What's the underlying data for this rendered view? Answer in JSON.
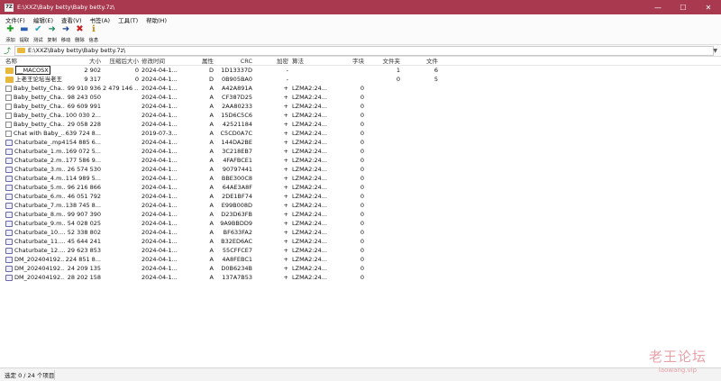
{
  "window": {
    "app_icon": "7Z",
    "title": "E:\\XXZ\\Baby betty\\Baby betty.7z\\",
    "controls": [
      "minimize-icon",
      "maximize-icon",
      "close-icon"
    ]
  },
  "menu": [
    "文件(F)",
    "编辑(E)",
    "查看(V)",
    "书签(A)",
    "工具(T)",
    "帮助(H)"
  ],
  "toolbar": [
    {
      "name": "add",
      "label": "添加",
      "glyph": "✚",
      "color": "#1a9a22"
    },
    {
      "name": "extract",
      "label": "提取",
      "glyph": "▬",
      "color": "#2a5fb5"
    },
    {
      "name": "test",
      "label": "测试",
      "glyph": "✔",
      "color": "#23a3c7"
    },
    {
      "name": "copy",
      "label": "复制",
      "glyph": "➜",
      "color": "#1a8a5a"
    },
    {
      "name": "move",
      "label": "移动",
      "glyph": "➜",
      "color": "#1f3f9a"
    },
    {
      "name": "delete",
      "label": "删除",
      "glyph": "✖",
      "color": "#c8221e"
    },
    {
      "name": "info",
      "label": "信息",
      "glyph": "ℹ",
      "color": "#c28a10"
    }
  ],
  "address": {
    "path": "E:\\XXZ\\Baby betty\\Baby betty.7z\\"
  },
  "columns": {
    "name": "名称",
    "size": "大小",
    "packed": "压缩后大小",
    "modified": "修改时间",
    "attr": "属性",
    "crc": "CRC",
    "encrypted": "加密",
    "method": "算法",
    "block": "字块",
    "folders": "文件夹",
    "files": "文件"
  },
  "rows": [
    {
      "icon": "folder",
      "name": "__MACOSX",
      "size": "2 902",
      "packed": "0",
      "modified": "2024-04-1...",
      "attr": "D",
      "crc": "1D13337D",
      "encrypted": "-",
      "method": "",
      "block": "",
      "folders": "1",
      "files": "6"
    },
    {
      "icon": "folder",
      "name": "上老王论坛当老王",
      "size": "9 317",
      "packed": "0",
      "modified": "2024-04-1...",
      "attr": "D",
      "crc": "0B905BA0",
      "encrypted": "-",
      "method": "",
      "block": "",
      "folders": "0",
      "files": "5"
    },
    {
      "icon": "file",
      "name": "Baby_betty_Cha...",
      "size": "99 910 936",
      "packed": "2 479 146 ...",
      "modified": "2024-04-1...",
      "attr": "A",
      "crc": "A42A891A",
      "encrypted": "+",
      "method": "LZMA2:24...",
      "block": "0",
      "folders": "",
      "files": ""
    },
    {
      "icon": "file",
      "name": "Baby_betty_Cha...",
      "size": "98 243 050",
      "packed": "",
      "modified": "2024-04-1...",
      "attr": "A",
      "crc": "CF387D25",
      "encrypted": "+",
      "method": "LZMA2:24...",
      "block": "0",
      "folders": "",
      "files": ""
    },
    {
      "icon": "file",
      "name": "Baby_betty_Cha...",
      "size": "69 609 991",
      "packed": "",
      "modified": "2024-04-1...",
      "attr": "A",
      "crc": "2AA80233",
      "encrypted": "+",
      "method": "LZMA2:24...",
      "block": "0",
      "folders": "",
      "files": ""
    },
    {
      "icon": "file",
      "name": "Baby_betty_Cha...",
      "size": "100 030 2...",
      "packed": "",
      "modified": "2024-04-1...",
      "attr": "A",
      "crc": "15D6C5C6",
      "encrypted": "+",
      "method": "LZMA2:24...",
      "block": "0",
      "folders": "",
      "files": ""
    },
    {
      "icon": "file",
      "name": "Baby_betty_Cha...",
      "size": "29 058 228",
      "packed": "",
      "modified": "2024-04-1...",
      "attr": "A",
      "crc": "42521184",
      "encrypted": "+",
      "method": "LZMA2:24...",
      "block": "0",
      "folders": "",
      "files": ""
    },
    {
      "icon": "file",
      "name": "Chat with Baby_...",
      "size": "639 724 8...",
      "packed": "",
      "modified": "2019-07-3...",
      "attr": "A",
      "crc": "C5CD0A7C",
      "encrypted": "+",
      "method": "LZMA2:24...",
      "block": "0",
      "folders": "",
      "files": ""
    },
    {
      "icon": "video",
      "name": "Chaturbate_.mp4",
      "size": "154 885 6...",
      "packed": "",
      "modified": "2024-04-1...",
      "attr": "A",
      "crc": "144DA2BE",
      "encrypted": "+",
      "method": "LZMA2:24...",
      "block": "0",
      "folders": "",
      "files": ""
    },
    {
      "icon": "video",
      "name": "Chaturbate_1.m...",
      "size": "169 072 5...",
      "packed": "",
      "modified": "2024-04-1...",
      "attr": "A",
      "crc": "3C218EB7",
      "encrypted": "+",
      "method": "LZMA2:24...",
      "block": "0",
      "folders": "",
      "files": ""
    },
    {
      "icon": "video",
      "name": "Chaturbate_2.m...",
      "size": "177 586 9...",
      "packed": "",
      "modified": "2024-04-1...",
      "attr": "A",
      "crc": "4FAFBCE1",
      "encrypted": "+",
      "method": "LZMA2:24...",
      "block": "0",
      "folders": "",
      "files": ""
    },
    {
      "icon": "video",
      "name": "Chaturbate_3.m...",
      "size": "26 574 530",
      "packed": "",
      "modified": "2024-04-1...",
      "attr": "A",
      "crc": "90797441",
      "encrypted": "+",
      "method": "LZMA2:24...",
      "block": "0",
      "folders": "",
      "files": ""
    },
    {
      "icon": "video",
      "name": "Chaturbate_4.m...",
      "size": "114 989 5...",
      "packed": "",
      "modified": "2024-04-1...",
      "attr": "A",
      "crc": "BBE300C8",
      "encrypted": "+",
      "method": "LZMA2:24...",
      "block": "0",
      "folders": "",
      "files": ""
    },
    {
      "icon": "video",
      "name": "Chaturbate_5.m...",
      "size": "96 216 866",
      "packed": "",
      "modified": "2024-04-1...",
      "attr": "A",
      "crc": "64AE3A8F",
      "encrypted": "+",
      "method": "LZMA2:24...",
      "block": "0",
      "folders": "",
      "files": ""
    },
    {
      "icon": "video",
      "name": "Chaturbate_6.m...",
      "size": "46 051 792",
      "packed": "",
      "modified": "2024-04-1...",
      "attr": "A",
      "crc": "2DE1BF74",
      "encrypted": "+",
      "method": "LZMA2:24...",
      "block": "0",
      "folders": "",
      "files": ""
    },
    {
      "icon": "video",
      "name": "Chaturbate_7.m...",
      "size": "138 745 8...",
      "packed": "",
      "modified": "2024-04-1...",
      "attr": "A",
      "crc": "E99B008D",
      "encrypted": "+",
      "method": "LZMA2:24...",
      "block": "0",
      "folders": "",
      "files": ""
    },
    {
      "icon": "video",
      "name": "Chaturbate_8.m...",
      "size": "99 907 390",
      "packed": "",
      "modified": "2024-04-1...",
      "attr": "A",
      "crc": "D23D63FB",
      "encrypted": "+",
      "method": "LZMA2:24...",
      "block": "0",
      "folders": "",
      "files": ""
    },
    {
      "icon": "video",
      "name": "Chaturbate_9.m...",
      "size": "54 028 025",
      "packed": "",
      "modified": "2024-04-1...",
      "attr": "A",
      "crc": "9A9BBDD9",
      "encrypted": "+",
      "method": "LZMA2:24...",
      "block": "0",
      "folders": "",
      "files": ""
    },
    {
      "icon": "video",
      "name": "Chaturbate_10....",
      "size": "52 338 802",
      "packed": "",
      "modified": "2024-04-1...",
      "attr": "A",
      "crc": "BF633FA2",
      "encrypted": "+",
      "method": "LZMA2:24...",
      "block": "0",
      "folders": "",
      "files": ""
    },
    {
      "icon": "video",
      "name": "Chaturbate_11....",
      "size": "45 644 241",
      "packed": "",
      "modified": "2024-04-1...",
      "attr": "A",
      "crc": "B32ED6AC",
      "encrypted": "+",
      "method": "LZMA2:24...",
      "block": "0",
      "folders": "",
      "files": ""
    },
    {
      "icon": "video",
      "name": "Chaturbate_12....",
      "size": "29 623 853",
      "packed": "",
      "modified": "2024-04-1...",
      "attr": "A",
      "crc": "55CFFCE7",
      "encrypted": "+",
      "method": "LZMA2:24...",
      "block": "0",
      "folders": "",
      "files": ""
    },
    {
      "icon": "video",
      "name": "DM_202404192...",
      "size": "224 851 8...",
      "packed": "",
      "modified": "2024-04-1...",
      "attr": "A",
      "crc": "4A8FEBC1",
      "encrypted": "+",
      "method": "LZMA2:24...",
      "block": "0",
      "folders": "",
      "files": ""
    },
    {
      "icon": "video",
      "name": "DM_202404192...",
      "size": "24 209 135",
      "packed": "",
      "modified": "2024-04-1...",
      "attr": "A",
      "crc": "D0B6234B",
      "encrypted": "+",
      "method": "LZMA2:24...",
      "block": "0",
      "folders": "",
      "files": ""
    },
    {
      "icon": "video",
      "name": "DM_202404192...",
      "size": "28 202 158",
      "packed": "",
      "modified": "2024-04-1...",
      "attr": "A",
      "crc": "137A7B53",
      "encrypted": "+",
      "method": "LZMA2:24...",
      "block": "0",
      "folders": "",
      "files": ""
    }
  ],
  "status": {
    "selection": "选定 0 / 24 个项目"
  },
  "watermark": {
    "title": "老王论坛",
    "url": "laowang.vip"
  }
}
